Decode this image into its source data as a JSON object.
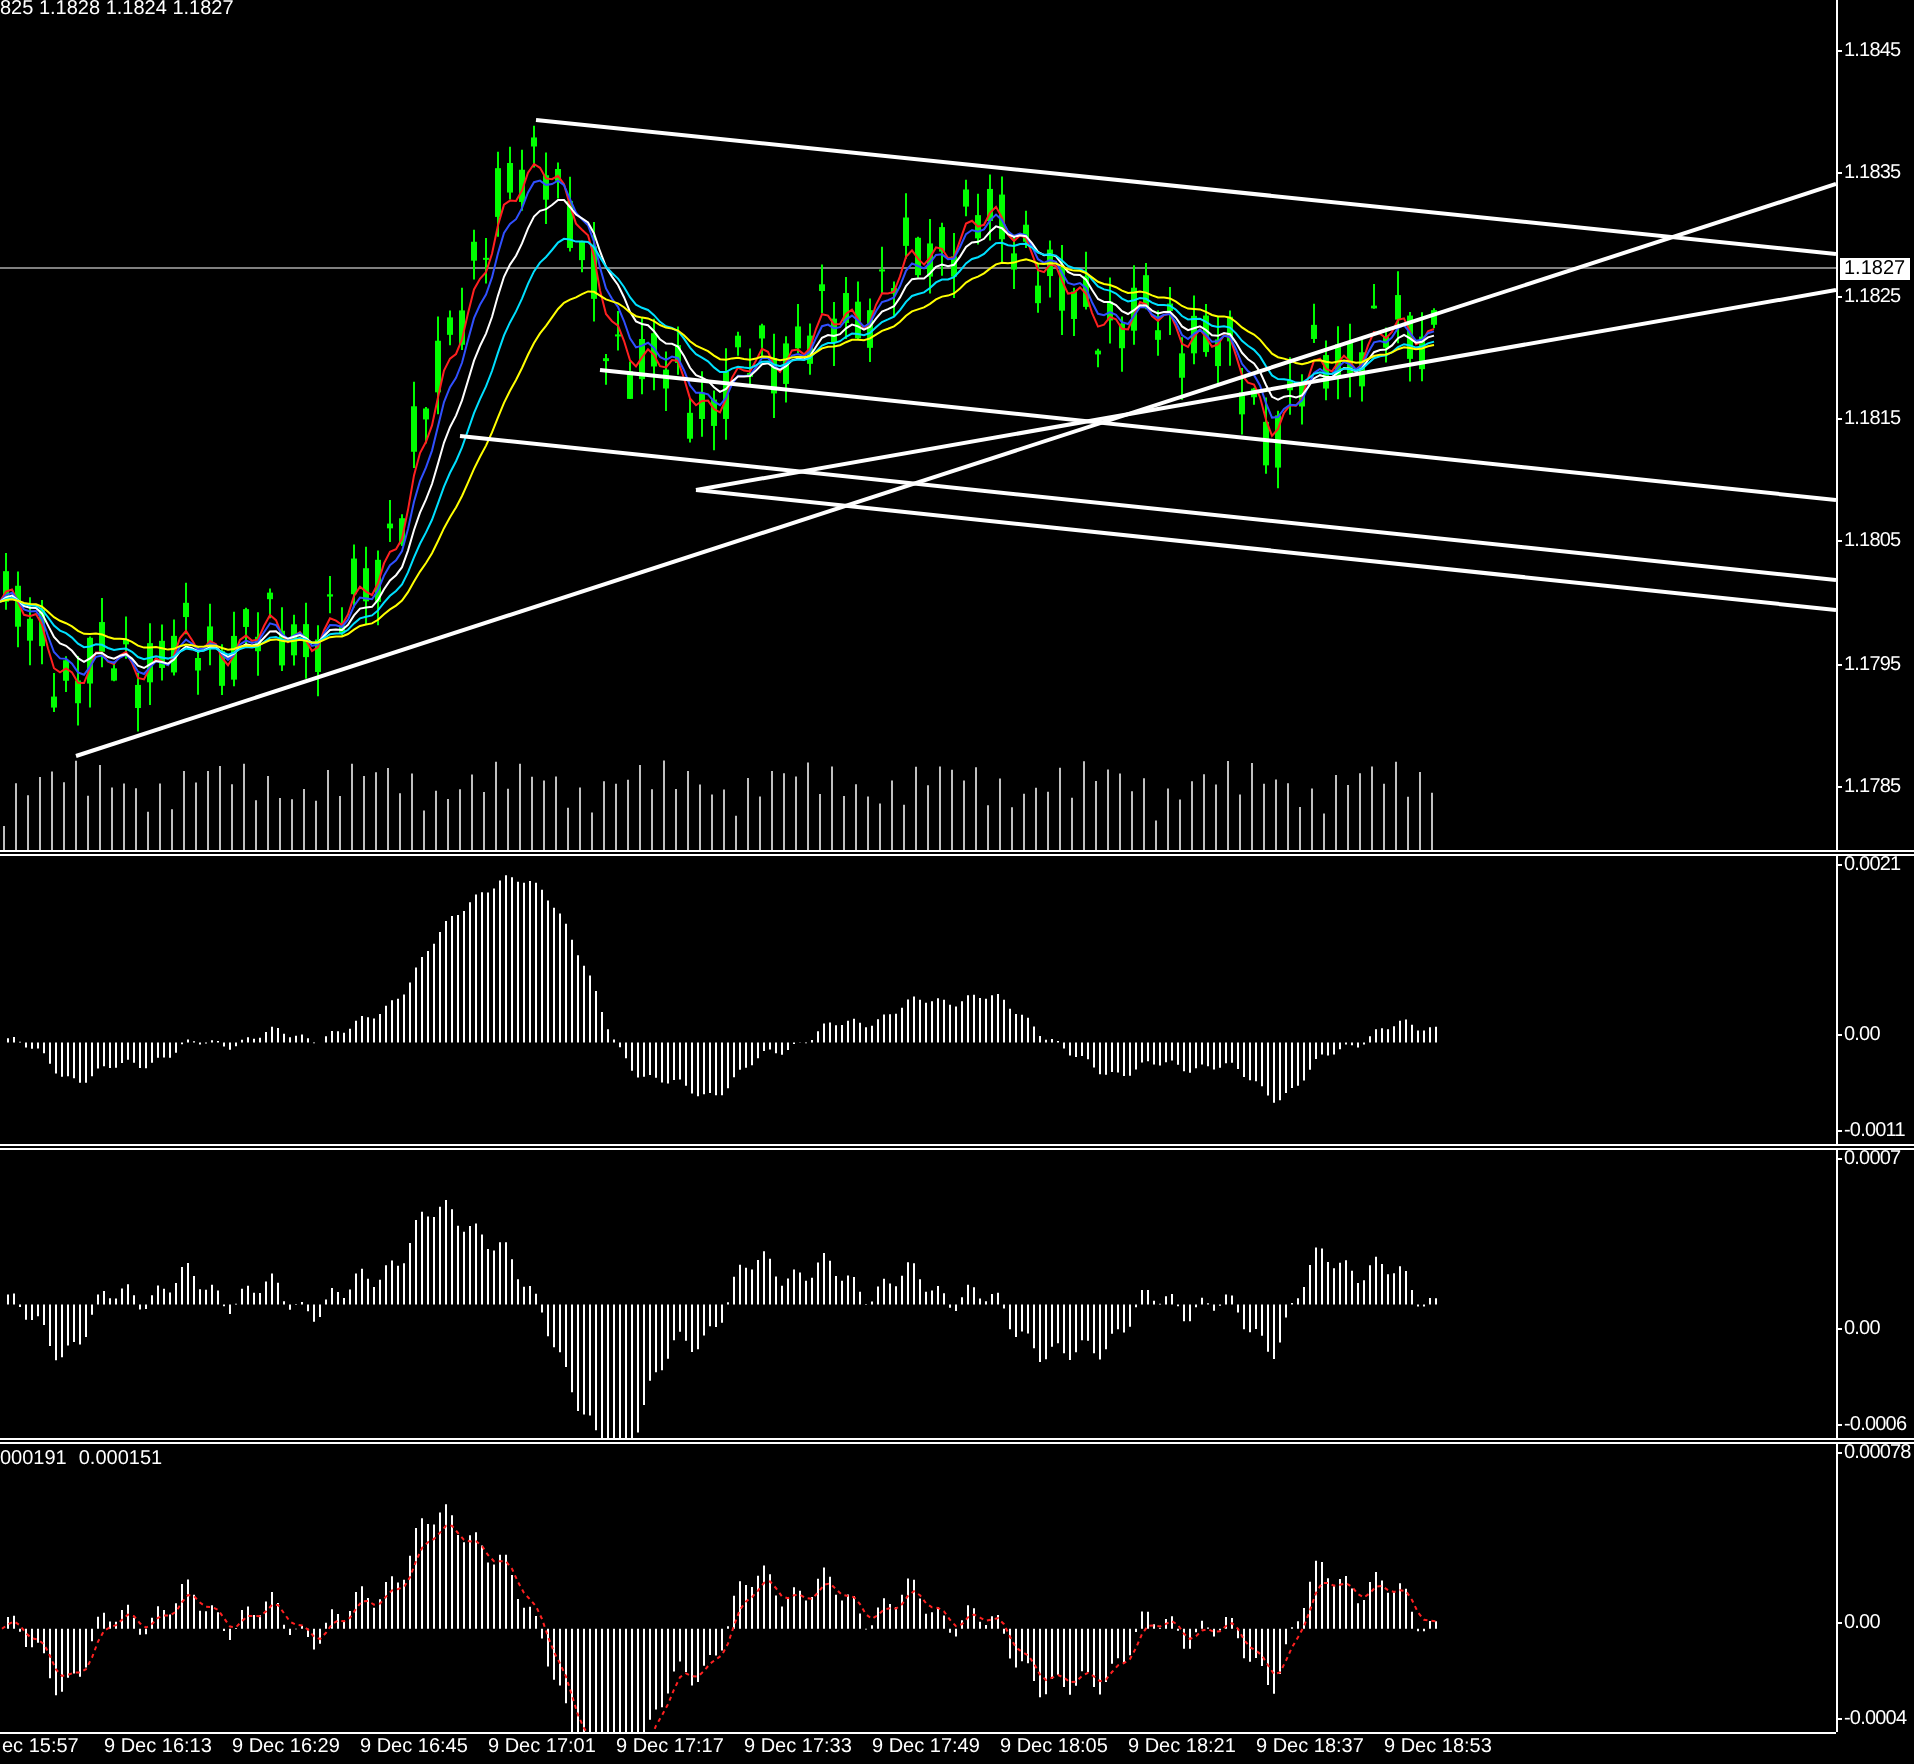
{
  "header": {
    "ohlc": "825 1.1828 1.1824 1.1827"
  },
  "main_panel": {
    "price_ticks": [
      "1.1845",
      "1.1835",
      "1.1825",
      "1.1815",
      "1.1805",
      "1.1795",
      "1.1785"
    ],
    "current_price": "1.1827"
  },
  "panels": [
    {
      "ticks": [
        "0.0021",
        "0.00",
        "-0.0011"
      ]
    },
    {
      "ticks": [
        "0.0007",
        "0.00",
        "-0.0006"
      ]
    },
    {
      "values": [
        "000191",
        "0.000151"
      ],
      "ticks": [
        "0.00078",
        "0.00",
        "-0.0004"
      ]
    }
  ],
  "time_axis": [
    "ec 15:57",
    "9 Dec 16:13",
    "9 Dec 16:29",
    "9 Dec 16:45",
    "9 Dec 17:01",
    "9 Dec 17:17",
    "9 Dec 17:33",
    "9 Dec 17:49",
    "9 Dec 18:05",
    "9 Dec 18:21",
    "9 Dec 18:37",
    "9 Dec 18:53"
  ]
}
